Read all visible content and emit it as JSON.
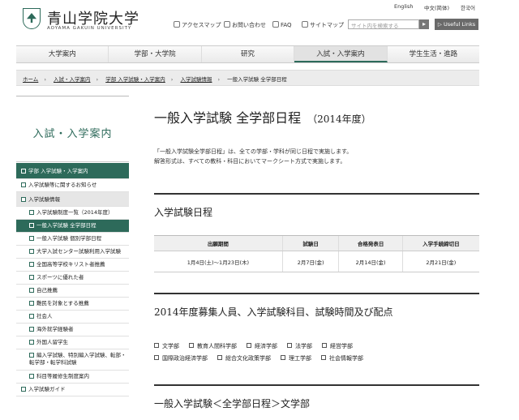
{
  "header": {
    "university_jp": "青山学院大学",
    "university_en": "AOYAMA GAKUIN UNIVERSITY",
    "languages": [
      "English",
      "中文(简体)",
      "한국어"
    ],
    "utility_links": [
      "アクセスマップ",
      "お問い合わせ",
      "FAQ",
      "サイトマップ"
    ],
    "search_placeholder": "サイト内を検索する",
    "search_button": "▸",
    "useful_links": "▷ Useful Links"
  },
  "globalnav": [
    "大学案内",
    "学部・大学院",
    "研究",
    "入試・入学案内",
    "学生生活・進路"
  ],
  "breadcrumb": [
    "ホーム",
    "入試・入学案内",
    "学部 入学試験・入学案内",
    "入学試験情報",
    "一般入学試験 全学部日程"
  ],
  "sidebar": {
    "title": "入試・入学案内",
    "top": "学部 入学試験・入学案内",
    "items": [
      {
        "label": "入学試験等に関するお知らせ",
        "type": "sec-plain"
      },
      {
        "label": "入学試験情報",
        "type": "sec"
      },
      {
        "label": "入学試験制度一覧（2014年度）",
        "type": "sub"
      },
      {
        "label": "一般入学試験 全学部日程",
        "type": "cur"
      },
      {
        "label": "一般入学試験 個別学部日程",
        "type": "sub"
      },
      {
        "label": "大学入試センター試験利用入学試験",
        "type": "sub"
      },
      {
        "label": "全国高等学校キリスト者推薦",
        "type": "sub"
      },
      {
        "label": "スポーツに優れた者",
        "type": "sub"
      },
      {
        "label": "自己推薦",
        "type": "sub"
      },
      {
        "label": "難民を対象とする推薦",
        "type": "sub"
      },
      {
        "label": "社会人",
        "type": "sub"
      },
      {
        "label": "海外就学経験者",
        "type": "sub"
      },
      {
        "label": "外国人留学生",
        "type": "sub"
      },
      {
        "label": "編入学試験、特別編入学試験、転部・転学部・転学科試験",
        "type": "sub-tall"
      },
      {
        "label": "科目等履修生制度案内",
        "type": "sub"
      },
      {
        "label": "入学試験ガイド",
        "type": "sec-plain"
      }
    ]
  },
  "main": {
    "title": "一般入学試験 全学部日程",
    "title_year": "（2014年度）",
    "intro": [
      "「一般入学試験全学部日程」は、全ての学部・学科が同じ日程で実施します。",
      "解答形式は、すべての教科・科目においてマークシート方式で実施します。"
    ],
    "schedule_heading": "入学試験日程",
    "schedule_headers": [
      "出願期間",
      "試験日",
      "合格発表日",
      "入学手続締切日"
    ],
    "schedule_row": [
      "1月4日(土)〜1月23日(木)",
      "2月7日(金)",
      "2月14日(金)",
      "2月21日(金)"
    ],
    "recruit_heading": "2014年度募集人員、入学試験科目、試験時間及び配点",
    "faculties": [
      "文学部",
      "教育人間科学部",
      "経済学部",
      "法学部",
      "経営学部",
      "国際政治経済学部",
      "総合文化政策学部",
      "理工学部",
      "社会情報学部"
    ],
    "literature_heading": "一般入学試験＜全学部日程＞文学部"
  }
}
